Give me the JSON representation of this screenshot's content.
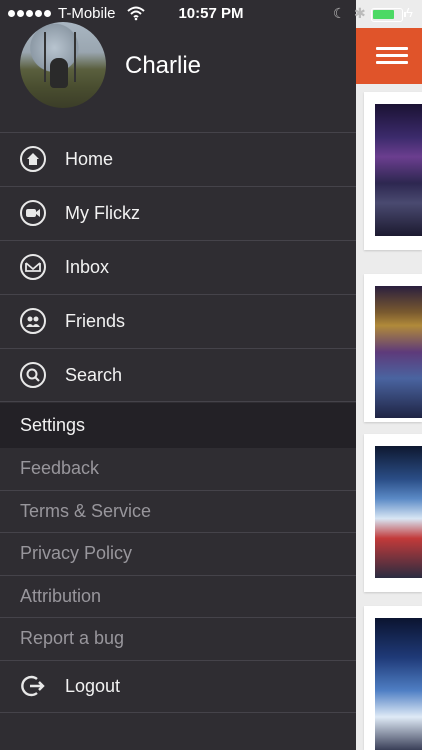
{
  "status_bar": {
    "carrier": "T-Mobile",
    "time": "10:57 PM",
    "icons": [
      "signal-dots-icon",
      "wifi-icon",
      "moon-icon",
      "bluetooth-icon",
      "battery-icon",
      "charging-bolt-icon"
    ]
  },
  "profile": {
    "name": "Charlie"
  },
  "menu": {
    "items": [
      {
        "label": "Home",
        "icon": "home-icon"
      },
      {
        "label": "My Flickz",
        "icon": "video-camera-icon"
      },
      {
        "label": "Inbox",
        "icon": "envelope-icon"
      },
      {
        "label": "Friends",
        "icon": "friends-icon"
      },
      {
        "label": "Search",
        "icon": "search-icon"
      }
    ]
  },
  "settings": {
    "header": "Settings",
    "items": [
      {
        "label": "Feedback"
      },
      {
        "label": "Terms & Service"
      },
      {
        "label": "Privacy Policy"
      },
      {
        "label": "Attribution"
      },
      {
        "label": "Report a bug"
      }
    ]
  },
  "logout": {
    "label": "Logout",
    "icon": "logout-icon"
  },
  "colors": {
    "drawer_bg": "#2f2d32",
    "settings_header_bg": "#232126",
    "accent": "#e0542a",
    "battery": "#4cd964"
  }
}
